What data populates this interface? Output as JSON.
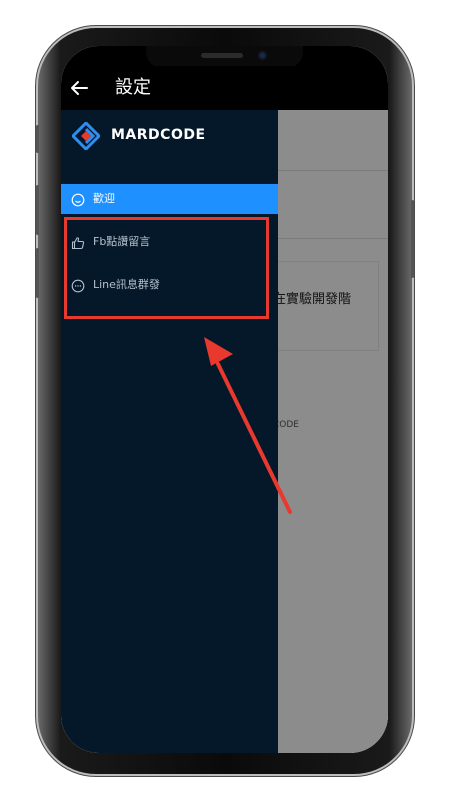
{
  "header": {
    "title": "設定"
  },
  "drawer": {
    "brand": "MARDCODE",
    "items": [
      {
        "label": "歡迎",
        "icon": "smile-icon",
        "active": true
      },
      {
        "label": "Fb點讚留言",
        "icon": "thumbs-up-icon",
        "active": false
      },
      {
        "label": "Line訊息群發",
        "icon": "chat-bubble-icon",
        "active": false
      }
    ]
  },
  "background_content": {
    "card_text": "在實驗開發階",
    "footer_text": "CODE"
  },
  "colors": {
    "drawer_bg": "#041829",
    "active_item": "#1e90ff",
    "highlight_border": "#e8392f",
    "brand_blue": "#2e8ef0",
    "brand_red": "#e8392f"
  }
}
